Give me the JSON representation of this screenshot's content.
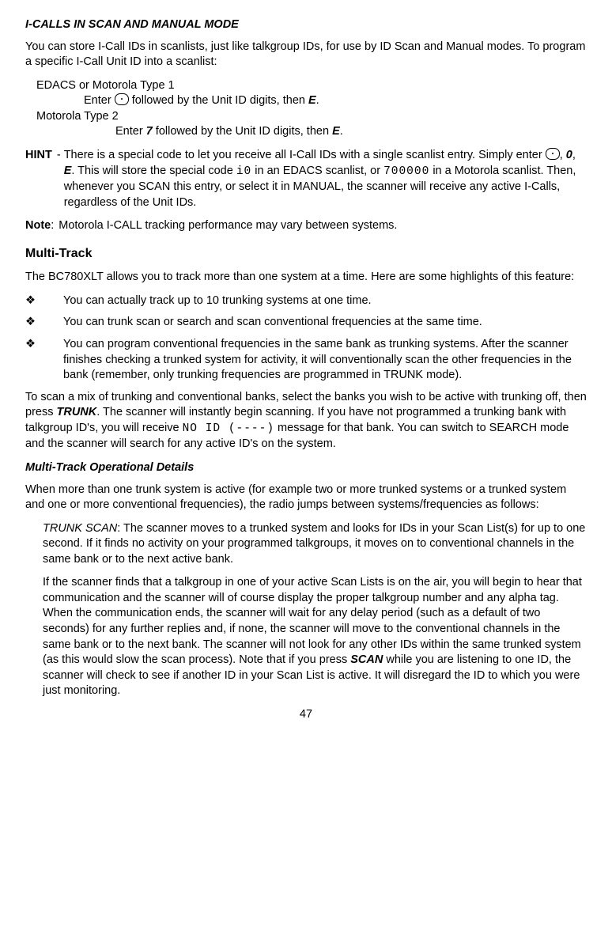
{
  "h1": "I-CALLS IN SCAN AND MANUAL MODE",
  "intro": "You can store I-Call IDs in scanlists, just like talkgroup IDs, for use by ID Scan and Manual modes. To program a specific I-Call Unit ID into a scanlist:",
  "edacs_title": "EDACS or Motorola Type 1",
  "edacs_enter_pre": "Enter ",
  "edacs_enter_mid": " followed by the Unit ID digits, then ",
  "edacs_enter_key": "E",
  "edacs_enter_end": ".",
  "moto_title": "Motorola Type 2",
  "moto_enter_pre": "Enter ",
  "moto_seven": "7",
  "moto_enter_mid": " followed by the Unit ID digits, then ",
  "moto_enter_key": "E",
  "moto_enter_end": ".",
  "hint_label": "HINT",
  "hint_p1_a": "There is a special code to let you receive all I-Call IDs with a single scanlist entry. Simply enter ",
  "hint_p1_b": ", ",
  "hint_zero": "0",
  "hint_comma": ", ",
  "hint_e": "E",
  "hint_p1_c": ". This will store the special code ",
  "hint_code1": "i0",
  "hint_p1_d": " in an EDACS scanlist, or ",
  "hint_code2": "700000",
  "hint_p1_e": " in a Motorola scanlist. Then, whenever you SCAN this entry, or select it in MANUAL, the scanner will receive any active I-Calls, regardless of the Unit IDs.",
  "note_label": "Note",
  "note_colon": ":",
  "note_body": "Motorola I-CALL tracking performance may vary between systems.",
  "multitrack_hdr": "Multi-Track",
  "multitrack_intro": "The BC780XLT allows you to track more than one system at a time. Here are some highlights of this feature:",
  "bul1": "You can actually track up to 10 trunking systems at one time.",
  "bul2": "You can trunk scan or search and scan conventional frequencies at the same time.",
  "bul3": "You can program conventional frequencies in the same bank as trunking systems. After the scanner finishes checking a trunked system for activity, it will conventionally scan the other frequencies in the bank (remember, only trunking frequencies are programmed in TRUNK mode).",
  "mixpara_a": "To scan a mix of trunking and conventional banks, select the banks you wish to be active with trunking off, then press ",
  "mixpara_trunk": "TRUNK",
  "mixpara_b": ". The scanner will instantly begin scanning. If you have not programmed a trunking bank with talkgroup ID's, you will receive ",
  "mixpara_code": "NO ID (----)",
  "mixpara_c": " message for that bank. You can switch to SEARCH mode and the scanner will search for any active ID's on the system.",
  "opdet_hdr": "Multi-Track Operational Details",
  "opdet_intro": "When more than one trunk system is active (for example two or more trunked systems or a trunked system and one or more conventional frequencies), the radio jumps between systems/frequencies as follows:",
  "trunkscan_label": "TRUNK SCAN",
  "trunkscan_body": ": The scanner moves to a trunked system and looks for IDs in your Scan List(s) for up to one second. If it finds no activity on your programmed talkgroups, it moves on to conventional channels in the same bank or to the next active bank.",
  "trunkscan2_a": "If the scanner finds that a talkgroup in one of your active Scan Lists is on the air, you will begin to hear that communication and the scanner will of course display the proper talkgroup number and any alpha tag. When the communication ends, the scanner will wait for any delay period (such as a default of two seconds) for any further replies and, if none, the scanner will move to the conventional channels in the same bank or to the next bank. The scanner will not look for any other IDs within the same trunked system (as this would slow the scan process). Note that if you press ",
  "trunkscan2_scan": "SCAN",
  "trunkscan2_b": " while you are listening to one ID, the scanner will check to see if another ID in your Scan List is active. It will disregard the ID to which you were just monitoring.",
  "pagenum": "47",
  "bullet_char": "❖"
}
